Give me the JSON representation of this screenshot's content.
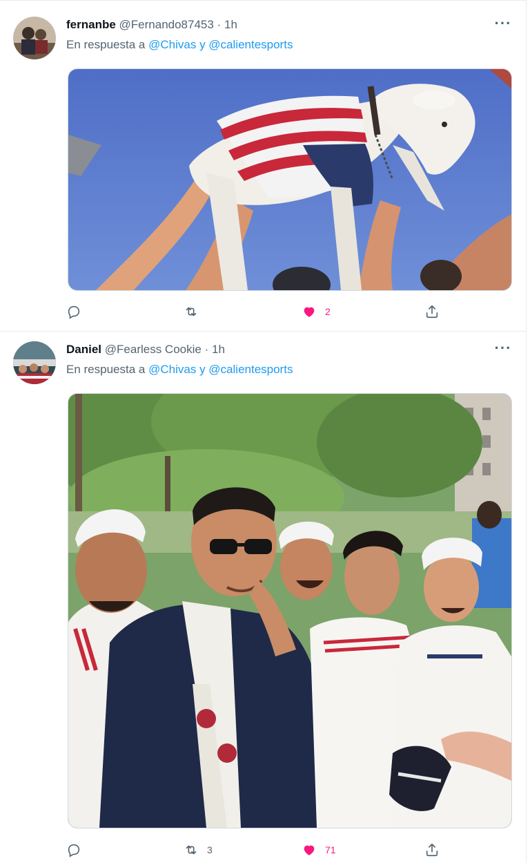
{
  "tweets": [
    {
      "name": "fernanbe",
      "handle": "@Fernando87453",
      "separator": "·",
      "time": "1h",
      "reply_prefix": "En respuesta a",
      "mention1": "@Chivas",
      "reply_join": "y",
      "mention2": "@calientesports",
      "replies": "",
      "retweets": "",
      "likes": "2",
      "liked": true,
      "media_icon": "goat-in-striped-jersey-photo"
    },
    {
      "name": "Daniel",
      "handle": "@Fearless Cookie",
      "separator": "·",
      "time": "1h",
      "reply_prefix": "En respuesta a",
      "mention1": "@Chivas",
      "reply_join": "y",
      "mention2": "@calientesports",
      "replies": "",
      "retweets": "3",
      "likes": "71",
      "liked": true,
      "media_icon": "group-of-fans-photo"
    }
  ],
  "colors": {
    "accent": "#1d9bf0",
    "like": "#f91880",
    "muted": "#536471"
  },
  "icons": [
    "reply-icon",
    "retweet-icon",
    "like-icon",
    "share-icon",
    "more-icon"
  ]
}
